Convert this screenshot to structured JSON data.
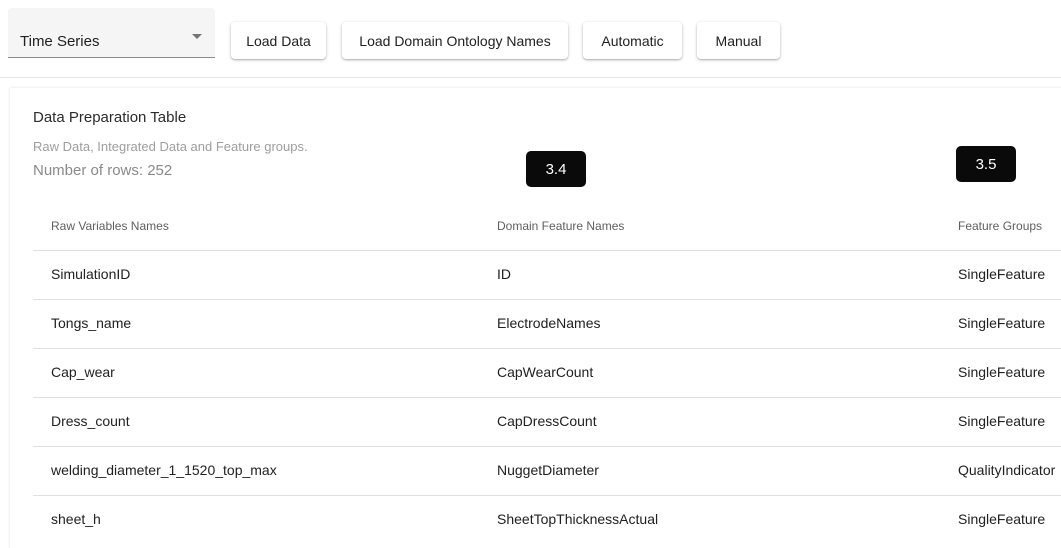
{
  "toolbar": {
    "select": {
      "value": "Time Series"
    },
    "buttons": {
      "load_data": "Load Data",
      "load_ontology": "Load Domain Ontology Names",
      "automatic": "Automatic",
      "manual": "Manual"
    }
  },
  "card": {
    "title": "Data Preparation Table",
    "subtitle": "Raw Data, Integrated Data and Feature groups.",
    "row_count": "Number of rows: 252"
  },
  "markers": {
    "m1": "3.4",
    "m2": "3.5"
  },
  "table": {
    "headers": {
      "raw": "Raw Variables Names",
      "domain": "Domain Feature Names",
      "group": "Feature Groups"
    },
    "rows": [
      {
        "raw": "SimulationID",
        "domain": "ID",
        "group": "SingleFeature"
      },
      {
        "raw": "Tongs_name",
        "domain": "ElectrodeNames",
        "group": "SingleFeature"
      },
      {
        "raw": "Cap_wear",
        "domain": "CapWearCount",
        "group": "SingleFeature"
      },
      {
        "raw": "Dress_count",
        "domain": "CapDressCount",
        "group": "SingleFeature"
      },
      {
        "raw": "welding_diameter_1_1520_top_max",
        "domain": "NuggetDiameter",
        "group": "QualityIndicator"
      },
      {
        "raw": "sheet_h",
        "domain": "SheetTopThicknessActual",
        "group": "SingleFeature"
      }
    ]
  }
}
